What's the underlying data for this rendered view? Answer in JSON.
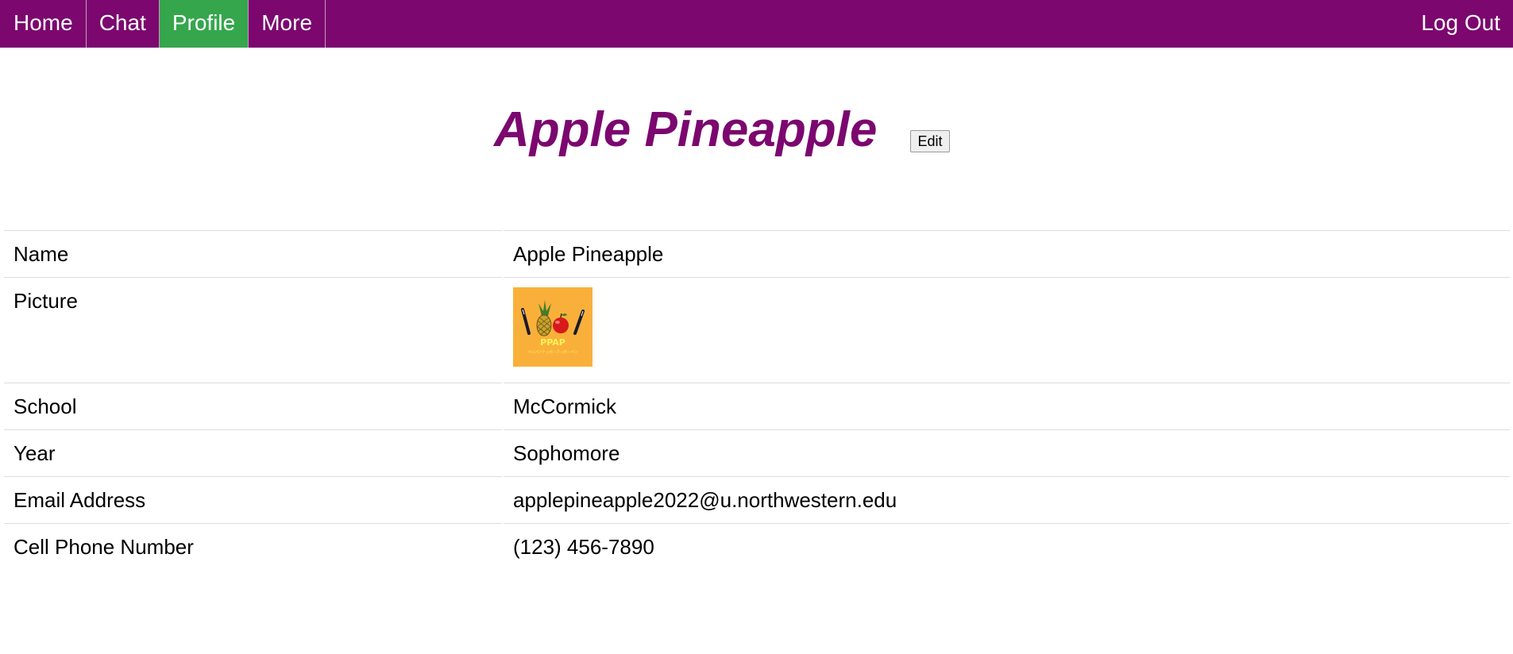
{
  "nav": {
    "items": [
      {
        "label": "Home",
        "active": false
      },
      {
        "label": "Chat",
        "active": false
      },
      {
        "label": "Profile",
        "active": true
      },
      {
        "label": "More",
        "active": false
      }
    ],
    "logout_label": "Log Out"
  },
  "profile": {
    "title": "Apple Pineapple",
    "edit_label": "Edit",
    "picture_text": "PPAP",
    "picture_subtext": "ペンパイナッポーアッポーペン",
    "rows": {
      "name": {
        "label": "Name",
        "value": "Apple Pineapple"
      },
      "picture": {
        "label": "Picture"
      },
      "school": {
        "label": "School",
        "value": "McCormick"
      },
      "year": {
        "label": "Year",
        "value": "Sophomore"
      },
      "email": {
        "label": "Email Address",
        "value": "applepineapple2022@u.northwestern.edu"
      },
      "phone": {
        "label": "Cell Phone Number",
        "value": "(123) 456-7890"
      }
    }
  },
  "colors": {
    "nav_bg": "#7b076f",
    "nav_active": "#35a64c",
    "title": "#7b076f",
    "picture_bg": "#f9b03a"
  }
}
